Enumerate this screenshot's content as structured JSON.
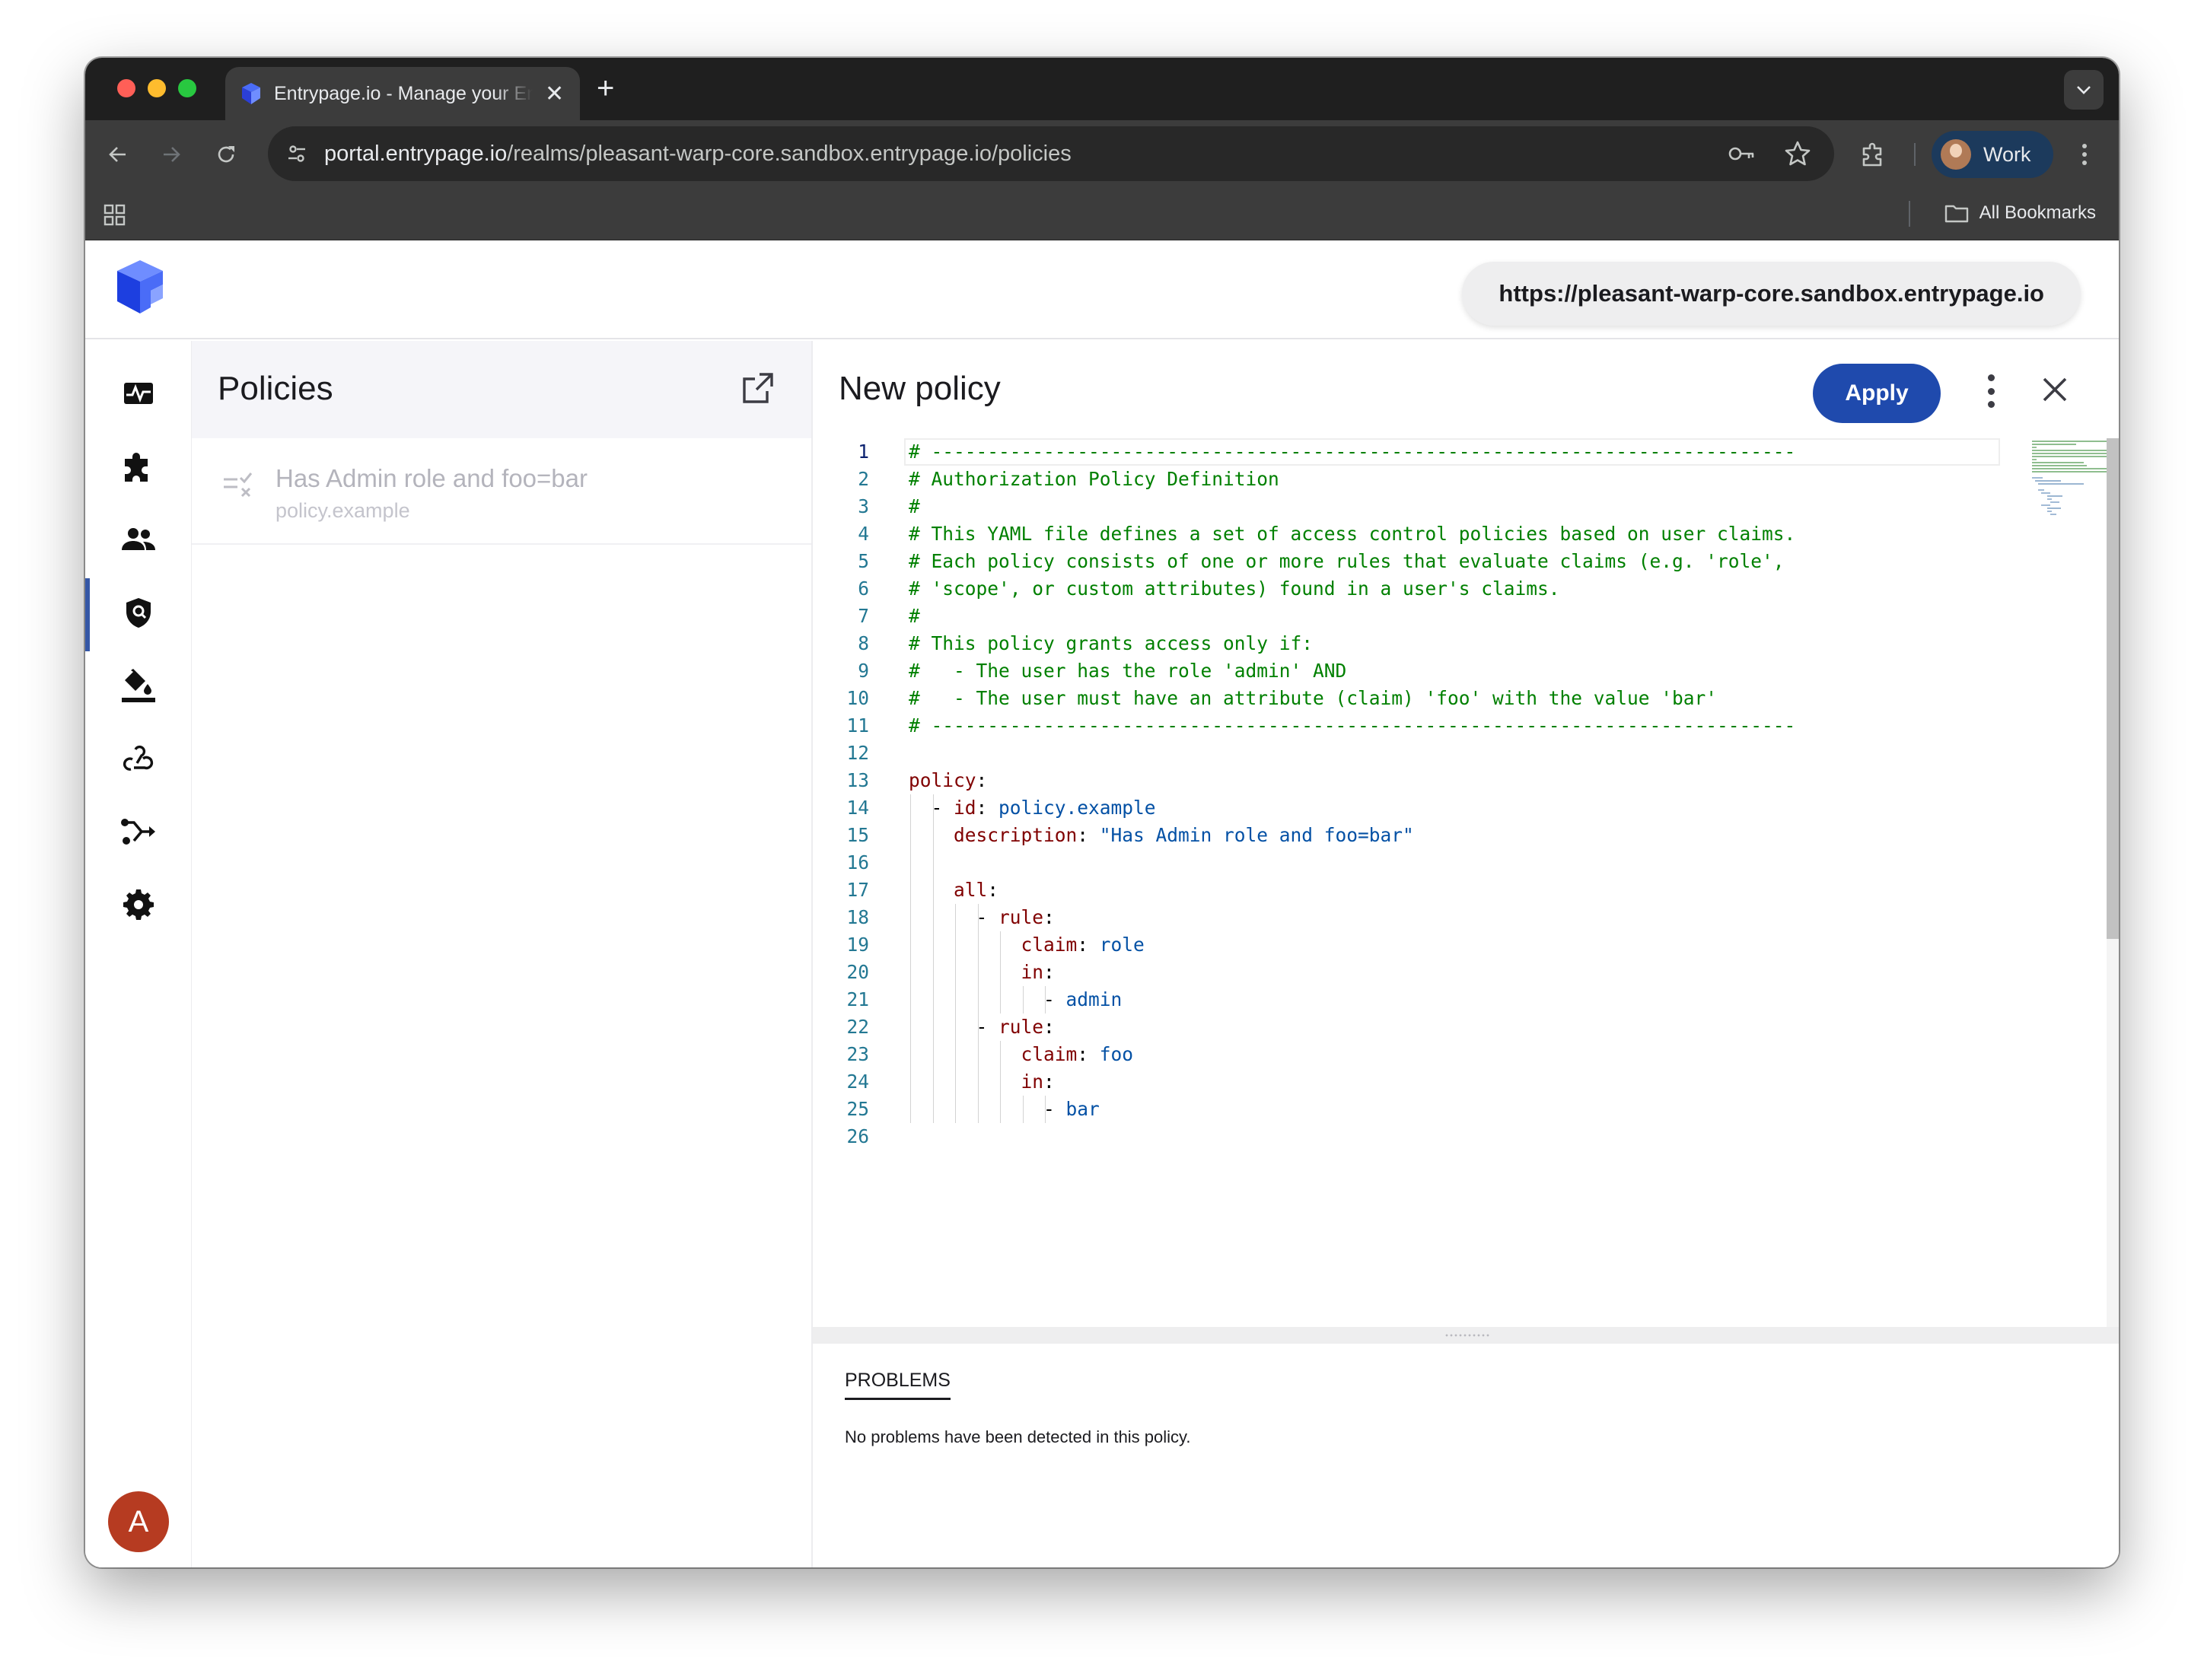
{
  "browser": {
    "tab_title": "Entrypage.io - Manage your Entrypage",
    "url_host": "portal.entrypage.io",
    "url_path": "/realms/pleasant-warp-core.sandbox.entrypage.io/policies",
    "profile_name": "Work",
    "bookmarks_label": "All Bookmarks"
  },
  "header": {
    "realm_url": "https://pleasant-warp-core.sandbox.entrypage.io"
  },
  "rail": {
    "items": [
      "dashboard-icon",
      "extensions-icon",
      "users-icon",
      "policies-icon",
      "branding-icon",
      "webhooks-icon",
      "flows-icon",
      "settings-icon"
    ],
    "active_index": 3,
    "avatar_letter": "A"
  },
  "policies_panel": {
    "title": "Policies",
    "items": [
      {
        "name": "Has Admin role and foo=bar",
        "id": "policy.example"
      }
    ]
  },
  "editor": {
    "title": "New policy",
    "apply_label": "Apply",
    "current_line": 1,
    "lines": [
      [
        [
          "c",
          "# -----------------------------------------------------------------------------"
        ]
      ],
      [
        [
          "c",
          "# Authorization Policy Definition"
        ]
      ],
      [
        [
          "c",
          "#"
        ]
      ],
      [
        [
          "c",
          "# This YAML file defines a set of access control policies based on user claims."
        ]
      ],
      [
        [
          "c",
          "# Each policy consists of one or more rules that evaluate claims (e.g. 'role',"
        ]
      ],
      [
        [
          "c",
          "# 'scope', or custom attributes) found in a user's claims."
        ]
      ],
      [
        [
          "c",
          "#"
        ]
      ],
      [
        [
          "c",
          "# This policy grants access only if:"
        ]
      ],
      [
        [
          "c",
          "#   - The user has the role 'admin' AND"
        ]
      ],
      [
        [
          "c",
          "#   - The user must have an attribute (claim) 'foo' with the value 'bar'"
        ]
      ],
      [
        [
          "c",
          "# -----------------------------------------------------------------------------"
        ]
      ],
      [],
      [
        [
          "k",
          "policy"
        ],
        [
          "p",
          ":"
        ]
      ],
      [
        [
          "p",
          "  - "
        ],
        [
          "k",
          "id"
        ],
        [
          "p",
          ": "
        ],
        [
          "v",
          "policy.example"
        ]
      ],
      [
        [
          "p",
          "    "
        ],
        [
          "k",
          "description"
        ],
        [
          "p",
          ": "
        ],
        [
          "s",
          "\"Has Admin role and foo=bar\""
        ]
      ],
      [],
      [
        [
          "p",
          "    "
        ],
        [
          "k",
          "all"
        ],
        [
          "p",
          ":"
        ]
      ],
      [
        [
          "p",
          "      - "
        ],
        [
          "k",
          "rule"
        ],
        [
          "p",
          ":"
        ]
      ],
      [
        [
          "p",
          "          "
        ],
        [
          "k",
          "claim"
        ],
        [
          "p",
          ": "
        ],
        [
          "v",
          "role"
        ]
      ],
      [
        [
          "p",
          "          "
        ],
        [
          "k",
          "in"
        ],
        [
          "p",
          ":"
        ]
      ],
      [
        [
          "p",
          "            - "
        ],
        [
          "v",
          "admin"
        ]
      ],
      [
        [
          "p",
          "      - "
        ],
        [
          "k",
          "rule"
        ],
        [
          "p",
          ":"
        ]
      ],
      [
        [
          "p",
          "          "
        ],
        [
          "k",
          "claim"
        ],
        [
          "p",
          ": "
        ],
        [
          "v",
          "foo"
        ]
      ],
      [
        [
          "p",
          "          "
        ],
        [
          "k",
          "in"
        ],
        [
          "p",
          ":"
        ]
      ],
      [
        [
          "p",
          "            - "
        ],
        [
          "v",
          "bar"
        ]
      ],
      []
    ]
  },
  "problems": {
    "tab_label": "PROBLEMS",
    "message": "No problems have been detected in this policy."
  },
  "colors": {
    "accent": "#1f4aad",
    "comment": "#008000",
    "key": "#800000",
    "value": "#0451a5",
    "line_number": "#237893",
    "avatar": "#b63b21"
  }
}
